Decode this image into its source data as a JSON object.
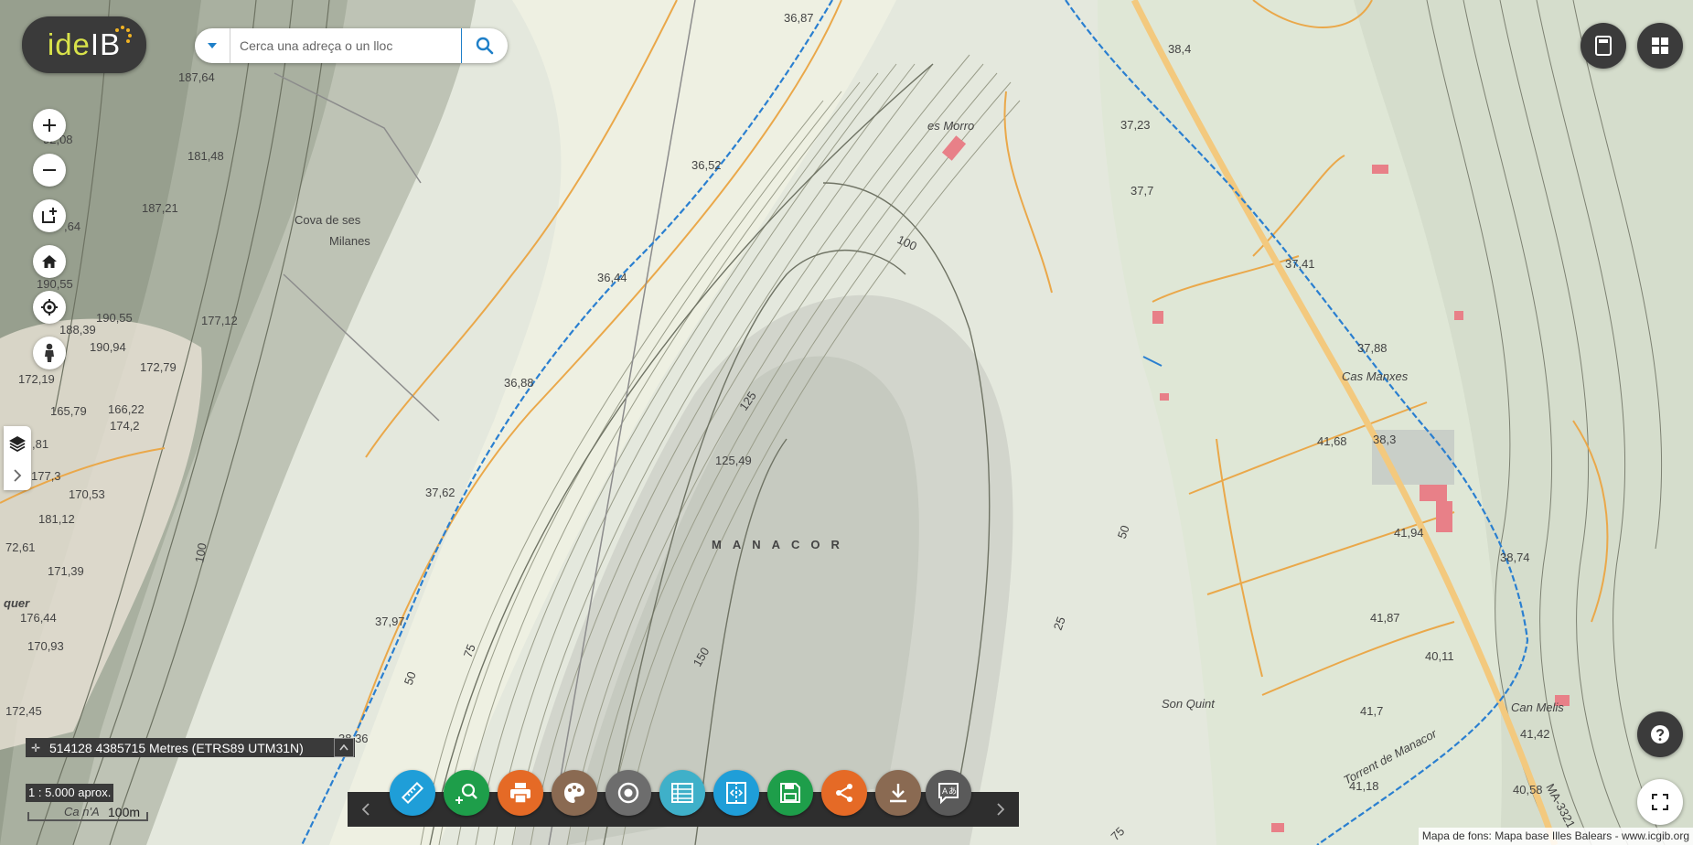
{
  "app": {
    "logo_text_a": "ide",
    "logo_text_b": "IB"
  },
  "search": {
    "placeholder": "Cerca una adreça o un lloc"
  },
  "map": {
    "town": "MANACOR",
    "place_labels": [
      "Cova de ses",
      "Milanes",
      "es Morro",
      "Cas Manxes",
      "Son Quint",
      "Can Melis",
      "Torrent de Manacor",
      "MA-3321",
      "quer",
      "Ca n'A"
    ],
    "spot_heights": [
      "187,64",
      "92,08",
      "181,48",
      "187,21",
      ",64",
      "190,55",
      "188,39",
      "190,55",
      "190,94",
      "177,12",
      "172,19",
      "172,79",
      "165,79",
      "166,22",
      "174,2",
      ",81",
      "177,3",
      "170,53",
      "181,12",
      "72,61",
      "171,39",
      "176,44",
      "170,93",
      "172,45",
      "36,87",
      "36,52",
      "36,44",
      "36,88",
      "37,62",
      "37,97",
      "38,36",
      "38,4",
      "37,23",
      "37,7",
      "37,41",
      "37,88",
      "38,3",
      "41,68",
      "41,94",
      "38,74",
      "41,87",
      "40,11",
      "41,7",
      "41,42",
      "41,18",
      "40,58",
      "125,49"
    ],
    "contour_labels": [
      "100",
      "125",
      "150",
      "75",
      "50",
      "100",
      "75",
      "50",
      "25"
    ]
  },
  "coords": {
    "text": "514128 4385715 Metres (ETRS89 UTM31N)"
  },
  "scale": {
    "ratio": "1 : 5.000 aprox.",
    "bar_label": "100m"
  },
  "attribution": "Mapa de fons: Mapa base Illes Balears - www.icgib.org",
  "colors": {
    "measure": "#1f9ed8",
    "zoom_search": "#1e9e4a",
    "print": "#e56a26",
    "draw": "#8a6a52",
    "buffer": "#6d6d6d",
    "legend": "#3fb0c9",
    "compare": "#1f9ed8",
    "save": "#1e9e4a",
    "share": "#e56a26",
    "download": "#8a6a52",
    "translate": "#5a5a5a"
  }
}
